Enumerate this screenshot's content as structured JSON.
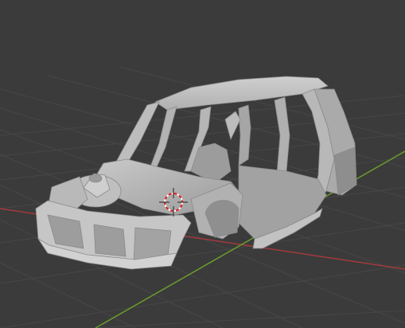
{
  "viewport": {
    "background_color": "#3b3b3b",
    "grid_color": "#454545",
    "x_axis_color": "#a33a3e",
    "y_axis_color": "#6a9c2c",
    "cursor_icon": "3d-cursor-icon",
    "object": "car-body-shell-mesh",
    "mesh_color": "#b4b4b4"
  }
}
